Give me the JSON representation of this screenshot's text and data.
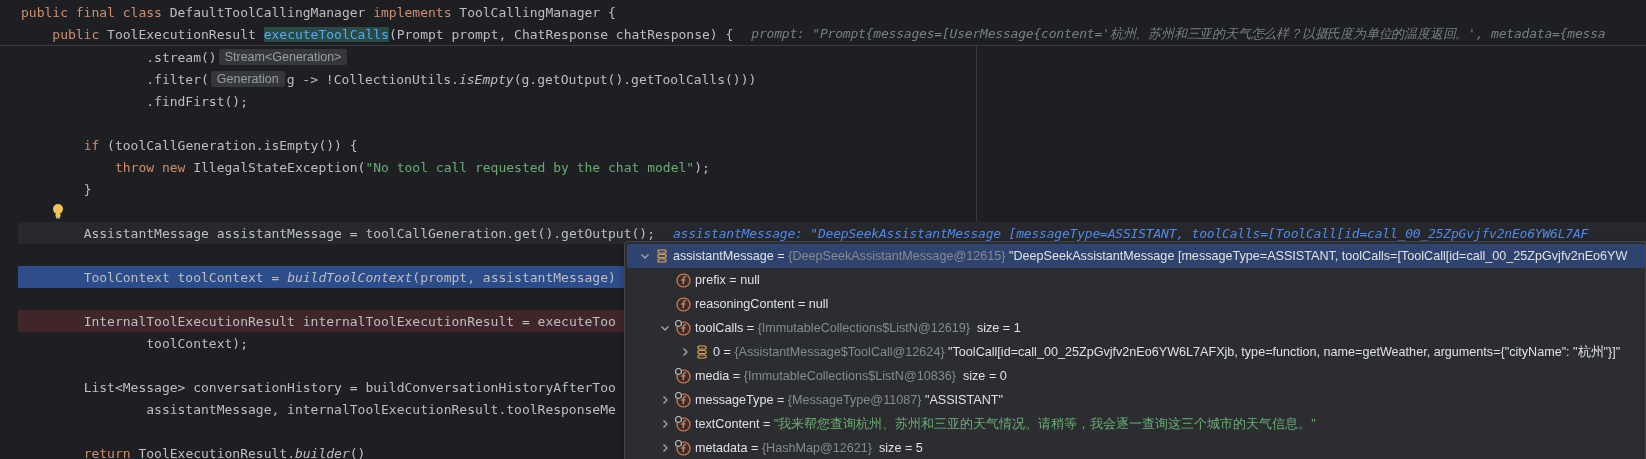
{
  "code": {
    "sticky_lines": [
      {
        "bulb": false,
        "segments": [
          {
            "kind": "code",
            "tokens": [
              {
                "text": "public final class ",
                "kind": "keyword"
              },
              {
                "text": "DefaultToolCallingManager ",
                "kind": "plain"
              },
              {
                "text": "implements ",
                "kind": "keyword"
              },
              {
                "text": "ToolCallingManager {",
                "kind": "plain"
              }
            ]
          }
        ]
      },
      {
        "bulb": false,
        "segments": [
          {
            "kind": "code",
            "tokens": [
              {
                "text": "    public ",
                "kind": "keyword"
              },
              {
                "text": "ToolExecutionResult ",
                "kind": "plain"
              },
              {
                "text": "executeToolCalls",
                "kind": "declaration"
              },
              {
                "text": "(Prompt prompt, ChatResponse chatResponse) {",
                "kind": "plain"
              }
            ]
          },
          {
            "kind": "inline_value",
            "highlighted": false,
            "text": "prompt: \"Prompt{messages=[UserMessage{content='杭州、苏州和三亚的天气怎么样？以摄氏度为单位的温度返回。', metadata={messa"
          }
        ]
      }
    ],
    "lines": [
      {
        "kind": "plain",
        "bulb": false,
        "segments": [
          {
            "kind": "code",
            "tokens": [
              {
                "text": "                .stream()",
                "kind": "plain"
              }
            ]
          },
          {
            "kind": "type_hint",
            "text": "Stream<Generation>"
          }
        ]
      },
      {
        "kind": "plain",
        "bulb": false,
        "segments": [
          {
            "kind": "code",
            "tokens": [
              {
                "text": "                .filter(",
                "kind": "plain"
              }
            ]
          },
          {
            "kind": "type_hint",
            "text": "Generation"
          },
          {
            "kind": "code",
            "tokens": [
              {
                "text": "g -> !CollectionUtils.",
                "kind": "plain"
              },
              {
                "text": "isEmpty",
                "kind": "italic"
              },
              {
                "text": "(g.getOutput().getToolCalls()))",
                "kind": "plain"
              }
            ]
          }
        ]
      },
      {
        "kind": "plain",
        "bulb": false,
        "segments": [
          {
            "kind": "code",
            "tokens": [
              {
                "text": "                .findFirst();",
                "kind": "plain"
              }
            ]
          }
        ]
      },
      {
        "kind": "plain",
        "bulb": false
      },
      {
        "kind": "plain",
        "bulb": false,
        "segments": [
          {
            "kind": "code",
            "tokens": [
              {
                "text": "        if ",
                "kind": "keyword"
              },
              {
                "text": "(toolCallGeneration.isEmpty()) {",
                "kind": "plain"
              }
            ]
          }
        ]
      },
      {
        "kind": "plain",
        "bulb": false,
        "segments": [
          {
            "kind": "code",
            "tokens": [
              {
                "text": "            throw new ",
                "kind": "keyword"
              },
              {
                "text": "IllegalStateException(",
                "kind": "plain"
              },
              {
                "text": "\"No tool call requested by the chat model\"",
                "kind": "string"
              },
              {
                "text": ");",
                "kind": "plain"
              }
            ]
          }
        ]
      },
      {
        "kind": "plain",
        "bulb": false,
        "segments": [
          {
            "kind": "code",
            "tokens": [
              {
                "text": "        }",
                "kind": "plain"
              }
            ]
          }
        ]
      },
      {
        "kind": "plain",
        "bulb": true
      },
      {
        "kind": "caret",
        "bulb": false,
        "segments": [
          {
            "kind": "code",
            "tokens": [
              {
                "text": "        AssistantMessage assistantMessage = toolCallGeneration.get().getOutput();",
                "kind": "plain"
              }
            ]
          },
          {
            "kind": "inline_value",
            "highlighted": true,
            "text": "assistantMessage: \"DeepSeekAssistantMessage [messageType=ASSISTANT, toolCalls=[ToolCall[id=call_00_25ZpGvjfv2nEo6YW6L7AF"
          }
        ]
      },
      {
        "kind": "plain",
        "bulb": false
      },
      {
        "kind": "execution",
        "bulb": false,
        "segments": [
          {
            "kind": "code",
            "tokens": [
              {
                "text": "        ToolContext toolContext = ",
                "kind": "plain"
              },
              {
                "text": "buildToolContext",
                "kind": "italic"
              },
              {
                "text": "(prompt, assistantMessage)",
                "kind": "plain"
              }
            ]
          }
        ]
      },
      {
        "kind": "plain",
        "bulb": false
      },
      {
        "kind": "breakpoint",
        "bulb": false,
        "segments": [
          {
            "kind": "code",
            "tokens": [
              {
                "text": "        InternalToolExecutionResult internalToolExecutionResult = executeToo",
                "kind": "plain"
              }
            ]
          }
        ]
      },
      {
        "kind": "plain",
        "bulb": false,
        "segments": [
          {
            "kind": "code",
            "tokens": [
              {
                "text": "                toolContext);",
                "kind": "plain"
              }
            ]
          }
        ]
      },
      {
        "kind": "plain",
        "bulb": false
      },
      {
        "kind": "plain",
        "bulb": false,
        "segments": [
          {
            "kind": "code",
            "tokens": [
              {
                "text": "        List<Message> conversationHistory = buildConversationHistoryAfterToo",
                "kind": "plain"
              }
            ]
          }
        ]
      },
      {
        "kind": "plain",
        "bulb": false,
        "segments": [
          {
            "kind": "code",
            "tokens": [
              {
                "text": "                assistantMessage, internalToolExecutionResult.toolResponseMe",
                "kind": "plain"
              }
            ]
          }
        ]
      },
      {
        "kind": "plain",
        "bulb": false
      },
      {
        "kind": "plain",
        "bulb": false,
        "segments": [
          {
            "kind": "code",
            "tokens": [
              {
                "text": "        return ",
                "kind": "keyword"
              },
              {
                "text": "ToolExecutionResult.",
                "kind": "plain"
              },
              {
                "text": "builder",
                "kind": "italic"
              },
              {
                "text": "()",
                "kind": "plain"
              }
            ]
          }
        ]
      }
    ]
  },
  "popup": {
    "rows": [
      {
        "kind": "object",
        "selected": true,
        "expanded": true,
        "parts": [
          {
            "text": "assistantMessage",
            "kind": "name"
          },
          {
            "text": " = ",
            "kind": "op"
          },
          {
            "text": "{DeepSeekAssistantMessage@12615}",
            "kind": "ref"
          },
          {
            "text": " \"DeepSeekAssistantMessage [messageType=ASSISTANT, toolCalls=[ToolCall[id=call_00_25ZpGvjfv2nEo6YW",
            "kind": "value"
          }
        ],
        "children": [
          {
            "kind": "field",
            "selected": false,
            "parts": [
              {
                "text": "prefix",
                "kind": "name"
              },
              {
                "text": " = null",
                "kind": "op"
              }
            ]
          },
          {
            "kind": "field",
            "selected": false,
            "parts": [
              {
                "text": "reasoningContent",
                "kind": "name"
              },
              {
                "text": " = null",
                "kind": "op"
              }
            ]
          },
          {
            "kind": "field_final",
            "selected": false,
            "expanded": true,
            "parts": [
              {
                "text": "toolCalls",
                "kind": "name"
              },
              {
                "text": " = ",
                "kind": "op"
              },
              {
                "text": "{ImmutableCollections$ListN@12619}",
                "kind": "ref"
              },
              {
                "text": "  size = 1",
                "kind": "value"
              }
            ],
            "children": [
              {
                "kind": "object",
                "selected": false,
                "expanded": false,
                "parts": [
                  {
                    "text": "0",
                    "kind": "name"
                  },
                  {
                    "text": " = ",
                    "kind": "op"
                  },
                  {
                    "text": "{AssistantMessage$ToolCall@12624}",
                    "kind": "ref"
                  },
                  {
                    "text": " \"ToolCall[id=call_00_25ZpGvjfv2nEo6YW6L7AFXjb, type=function, name=getWeather, arguments={\"cityName\": \"杭州\"}]\"",
                    "kind": "value"
                  }
                ]
              }
            ]
          },
          {
            "kind": "field_final",
            "selected": false,
            "parts": [
              {
                "text": "media",
                "kind": "name"
              },
              {
                "text": " = ",
                "kind": "op"
              },
              {
                "text": "{ImmutableCollections$ListN@10836}",
                "kind": "ref"
              },
              {
                "text": "  size = 0",
                "kind": "value"
              }
            ]
          },
          {
            "kind": "field_final",
            "selected": false,
            "expanded": false,
            "parts": [
              {
                "text": "messageType",
                "kind": "name"
              },
              {
                "text": " = ",
                "kind": "op"
              },
              {
                "text": "{MessageType@11087}",
                "kind": "ref"
              },
              {
                "text": " \"ASSISTANT\"",
                "kind": "value"
              }
            ]
          },
          {
            "kind": "field_final",
            "selected": false,
            "expanded": false,
            "parts": [
              {
                "text": "textContent",
                "kind": "name"
              },
              {
                "text": " = ",
                "kind": "op"
              },
              {
                "text": "\"我来帮您查询杭州、苏州和三亚的天气情况。请稍等，我会逐一查询这三个城市的天气信息。\"",
                "kind": "string"
              }
            ]
          },
          {
            "kind": "field_final",
            "selected": false,
            "expanded": false,
            "parts": [
              {
                "text": "metadata",
                "kind": "name"
              },
              {
                "text": " = ",
                "kind": "op"
              },
              {
                "text": "{HashMap@12621}",
                "kind": "ref"
              },
              {
                "text": "  size = 5",
                "kind": "value"
              }
            ]
          }
        ]
      }
    ]
  }
}
